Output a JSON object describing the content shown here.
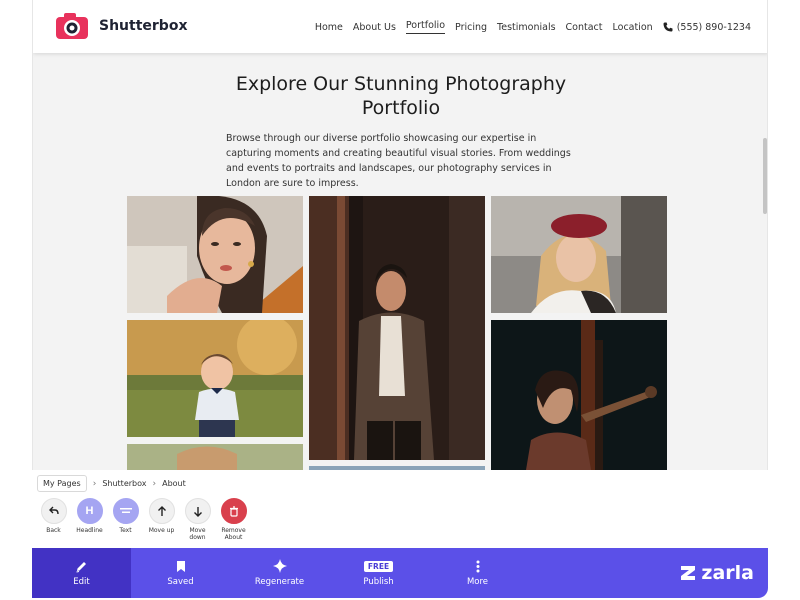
{
  "site": {
    "brand": "Shutterbox",
    "nav": {
      "home": "Home",
      "about": "About Us",
      "portfolio": "Portfolio",
      "pricing": "Pricing",
      "testimonials": "Testimonials",
      "contact": "Contact",
      "location": "Location",
      "phone": "(555) 890-1234"
    },
    "hero": {
      "title_line1": "Explore Our Stunning Photography",
      "title_line2": "Portfolio",
      "text": "Browse through our diverse portfolio showcasing our expertise in capturing moments and creating beautiful visual stories. From weddings and events to portraits and landscapes, our photography services in London are sure to impress."
    },
    "colors": {
      "accent": "#e8325c",
      "text": "#1f2333"
    }
  },
  "editor": {
    "breadcrumb": {
      "my_pages": "My Pages",
      "site": "Shutterbox",
      "page": "About"
    },
    "tools": {
      "back": "Back",
      "headline": "Headline",
      "text": "Text",
      "move_up": "Move up",
      "move_down_1": "Move",
      "move_down_2": "down",
      "remove_1": "Remove",
      "remove_2": "About",
      "headline_glyph": "H"
    },
    "actions": {
      "edit": "Edit",
      "saved": "Saved",
      "regenerate": "Regenerate",
      "free": "FREE",
      "publish": "Publish",
      "more": "More"
    },
    "brand": "zarla",
    "colors": {
      "bar": "#5b50e8",
      "active": "#4232c4",
      "purple_tool": "#a5a5f2",
      "remove": "#d9404d"
    }
  }
}
